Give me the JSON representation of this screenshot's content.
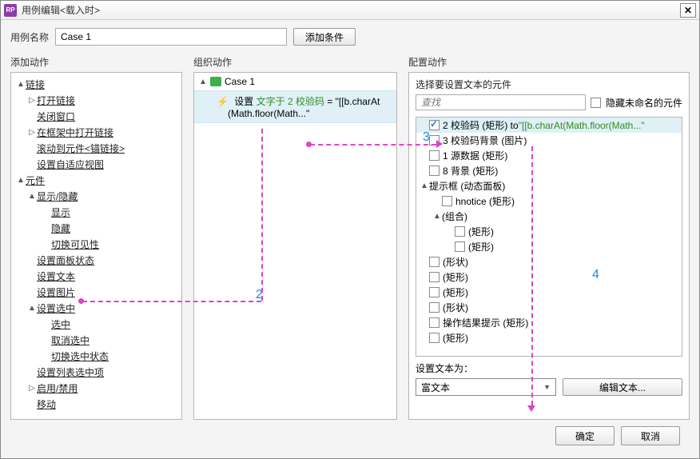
{
  "title": "用例编辑<载入时>",
  "close_x": "✕",
  "case_name_label": "用例名称",
  "case_name_value": "Case 1",
  "add_condition": "添加条件",
  "col_labels": {
    "add": "添加动作",
    "organize": "组织动作",
    "configure": "配置动作"
  },
  "tree": {
    "links": {
      "label": "链接",
      "open": "打开链接",
      "close_win": "关闭窗口",
      "open_in_frame": "在框架中打开链接",
      "scroll_to": "滚动到元件<锚链接>",
      "set_adaptive": "设置自适应视图"
    },
    "widgets": {
      "label": "元件",
      "show_hide": "显示/隐藏",
      "show": "显示",
      "hide": "隐藏",
      "toggle": "切换可见性",
      "panel_state": "设置面板状态",
      "set_text": "设置文本",
      "set_image": "设置图片",
      "set_selected": "设置选中",
      "selected": "选中",
      "deselect": "取消选中",
      "toggle_sel": "切换选中状态",
      "set_list_sel": "设置列表选中项",
      "enable_disable": "启用/禁用",
      "move": "移动"
    }
  },
  "org": {
    "case_label": "Case 1",
    "action_prefix": "设置",
    "action_mid": "文字于 2 校验码",
    "action_eq": " = \"[[b.charAt",
    "action_line2": "(Math.floor(Math...\""
  },
  "cfg": {
    "select_widget_header": "选择要设置文本的元件",
    "search_placeholder": "查找",
    "hide_unnamed": "隐藏未命名的元件",
    "items": [
      {
        "ind": 0,
        "tw": "",
        "cb": true,
        "checked": true,
        "sel": true,
        "text": "2 校验码 (矩形) to ",
        "tail": "\"[[b.charAt(Math.floor(Math...\""
      },
      {
        "ind": 0,
        "tw": "",
        "cb": true,
        "text": "3 校验码背景 (图片)"
      },
      {
        "ind": 0,
        "tw": "",
        "cb": true,
        "text": "1 源数据 (矩形)"
      },
      {
        "ind": 0,
        "tw": "",
        "cb": true,
        "text": "8 背景 (矩形)"
      },
      {
        "ind": 0,
        "tw": "▲",
        "cb": false,
        "text": "提示框 (动态面板)"
      },
      {
        "ind": 1,
        "tw": "",
        "cb": true,
        "text": "hnotice (矩形)"
      },
      {
        "ind": 1,
        "tw": "▲",
        "cb": false,
        "text": "(组合)"
      },
      {
        "ind": 2,
        "tw": "",
        "cb": true,
        "text": "(矩形)"
      },
      {
        "ind": 2,
        "tw": "",
        "cb": true,
        "text": "(矩形)"
      },
      {
        "ind": 0,
        "tw": "",
        "cb": true,
        "text": "(形状)"
      },
      {
        "ind": 0,
        "tw": "",
        "cb": true,
        "text": "(矩形)"
      },
      {
        "ind": 0,
        "tw": "",
        "cb": true,
        "text": "(矩形)"
      },
      {
        "ind": 0,
        "tw": "",
        "cb": true,
        "text": "(形状)"
      },
      {
        "ind": 0,
        "tw": "",
        "cb": true,
        "text": "操作结果提示 (矩形)"
      },
      {
        "ind": 0,
        "tw": "",
        "cb": true,
        "text": "(矩形)"
      }
    ],
    "set_text_as": "设置文本为：",
    "richtext": "富文本",
    "edit_text": "编辑文本..."
  },
  "footer": {
    "ok": "确定",
    "cancel": "取消"
  },
  "annotations": {
    "n2": "2",
    "n3": "3",
    "n4": "4"
  }
}
